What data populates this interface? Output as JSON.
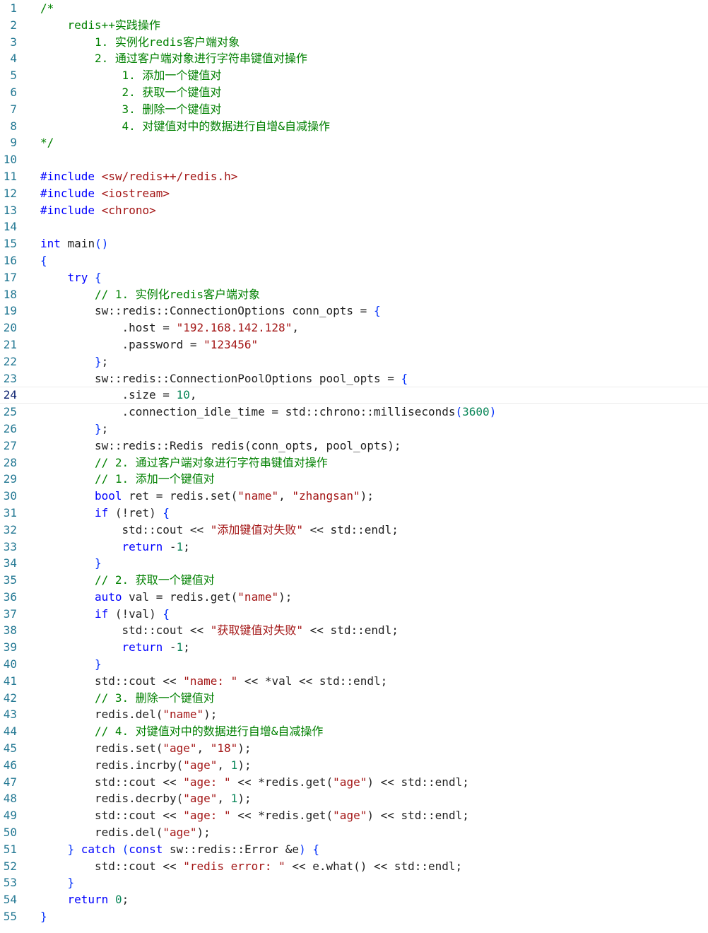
{
  "editor": {
    "current_line": 24,
    "lines": [
      {
        "n": "1",
        "indent": 0,
        "tokens": [
          {
            "t": "/*",
            "c": "comment"
          }
        ]
      },
      {
        "n": "2",
        "indent": 1,
        "tokens": [
          {
            "t": "redis++实践操作",
            "c": "comment"
          }
        ]
      },
      {
        "n": "3",
        "indent": 2,
        "tokens": [
          {
            "t": "1. 实例化redis客户端对象",
            "c": "comment"
          }
        ]
      },
      {
        "n": "4",
        "indent": 2,
        "tokens": [
          {
            "t": "2. 通过客户端对象进行字符串键值对操作",
            "c": "comment"
          }
        ]
      },
      {
        "n": "5",
        "indent": 3,
        "tokens": [
          {
            "t": "1. 添加一个键值对",
            "c": "comment"
          }
        ]
      },
      {
        "n": "6",
        "indent": 3,
        "tokens": [
          {
            "t": "2. 获取一个键值对",
            "c": "comment"
          }
        ]
      },
      {
        "n": "7",
        "indent": 3,
        "tokens": [
          {
            "t": "3. 删除一个键值对",
            "c": "comment"
          }
        ]
      },
      {
        "n": "8",
        "indent": 3,
        "tokens": [
          {
            "t": "4. 对键值对中的数据进行自增&自减操作",
            "c": "comment"
          }
        ]
      },
      {
        "n": "9",
        "indent": 0,
        "tokens": [
          {
            "t": "*/",
            "c": "comment"
          }
        ]
      },
      {
        "n": "10",
        "indent": 0,
        "tokens": []
      },
      {
        "n": "11",
        "indent": 0,
        "tokens": [
          {
            "t": "#include ",
            "c": "keyword"
          },
          {
            "t": "<sw/redis++/redis.h>",
            "c": "string"
          }
        ]
      },
      {
        "n": "12",
        "indent": 0,
        "tokens": [
          {
            "t": "#include ",
            "c": "keyword"
          },
          {
            "t": "<iostream>",
            "c": "string"
          }
        ]
      },
      {
        "n": "13",
        "indent": 0,
        "tokens": [
          {
            "t": "#include ",
            "c": "keyword"
          },
          {
            "t": "<chrono>",
            "c": "string"
          }
        ]
      },
      {
        "n": "14",
        "indent": 0,
        "tokens": []
      },
      {
        "n": "15",
        "indent": 0,
        "tokens": [
          {
            "t": "int",
            "c": "keyword"
          },
          {
            "t": " main",
            "c": "func"
          },
          {
            "t": "()",
            "c": "bracket"
          }
        ]
      },
      {
        "n": "16",
        "indent": 0,
        "tokens": [
          {
            "t": "{",
            "c": "bracket"
          }
        ]
      },
      {
        "n": "17",
        "indent": 1,
        "tokens": [
          {
            "t": "try",
            "c": "control"
          },
          {
            "t": " ",
            "c": "plain"
          },
          {
            "t": "{",
            "c": "bracket"
          }
        ]
      },
      {
        "n": "18",
        "indent": 2,
        "tokens": [
          {
            "t": "// 1. 实例化redis客户端对象",
            "c": "comment"
          }
        ]
      },
      {
        "n": "19",
        "indent": 2,
        "tokens": [
          {
            "t": "sw::redis::ConnectionOptions conn_opts = ",
            "c": "plain"
          },
          {
            "t": "{",
            "c": "bracket"
          }
        ]
      },
      {
        "n": "20",
        "indent": 3,
        "tokens": [
          {
            "t": ".host = ",
            "c": "plain"
          },
          {
            "t": "\"192.168.142.128\"",
            "c": "string"
          },
          {
            "t": ",",
            "c": "plain"
          }
        ]
      },
      {
        "n": "21",
        "indent": 3,
        "tokens": [
          {
            "t": ".password = ",
            "c": "plain"
          },
          {
            "t": "\"123456\"",
            "c": "string"
          }
        ]
      },
      {
        "n": "22",
        "indent": 2,
        "tokens": [
          {
            "t": "}",
            "c": "bracket"
          },
          {
            "t": ";",
            "c": "plain"
          }
        ]
      },
      {
        "n": "23",
        "indent": 2,
        "tokens": [
          {
            "t": "sw::redis::ConnectionPoolOptions pool_opts = ",
            "c": "plain"
          },
          {
            "t": "{",
            "c": "bracket"
          }
        ]
      },
      {
        "n": "24",
        "indent": 3,
        "tokens": [
          {
            "t": ".size = ",
            "c": "plain"
          },
          {
            "t": "10",
            "c": "number"
          },
          {
            "t": ",",
            "c": "plain"
          }
        ]
      },
      {
        "n": "25",
        "indent": 3,
        "tokens": [
          {
            "t": ".connection_idle_time = std::chrono::milliseconds",
            "c": "plain"
          },
          {
            "t": "(",
            "c": "bracket"
          },
          {
            "t": "3600",
            "c": "number"
          },
          {
            "t": ")",
            "c": "bracket"
          }
        ]
      },
      {
        "n": "26",
        "indent": 2,
        "tokens": [
          {
            "t": "}",
            "c": "bracket"
          },
          {
            "t": ";",
            "c": "plain"
          }
        ]
      },
      {
        "n": "27",
        "indent": 2,
        "tokens": [
          {
            "t": "sw::redis::Redis redis(conn_opts, pool_opts);",
            "c": "plain"
          }
        ]
      },
      {
        "n": "28",
        "indent": 2,
        "tokens": [
          {
            "t": "// 2. 通过客户端对象进行字符串键值对操作",
            "c": "comment"
          }
        ]
      },
      {
        "n": "29",
        "indent": 2,
        "tokens": [
          {
            "t": "// 1. 添加一个键值对",
            "c": "comment"
          }
        ]
      },
      {
        "n": "30",
        "indent": 2,
        "tokens": [
          {
            "t": "bool",
            "c": "keyword"
          },
          {
            "t": " ret = redis.set(",
            "c": "plain"
          },
          {
            "t": "\"name\"",
            "c": "string"
          },
          {
            "t": ", ",
            "c": "plain"
          },
          {
            "t": "\"zhangsan\"",
            "c": "string"
          },
          {
            "t": ");",
            "c": "plain"
          }
        ]
      },
      {
        "n": "31",
        "indent": 2,
        "tokens": [
          {
            "t": "if",
            "c": "control"
          },
          {
            "t": " (!ret) ",
            "c": "plain"
          },
          {
            "t": "{",
            "c": "bracket"
          }
        ]
      },
      {
        "n": "32",
        "indent": 3,
        "tokens": [
          {
            "t": "std::cout << ",
            "c": "plain"
          },
          {
            "t": "\"添加键值对失败\"",
            "c": "string"
          },
          {
            "t": " << std::endl;",
            "c": "plain"
          }
        ]
      },
      {
        "n": "33",
        "indent": 3,
        "tokens": [
          {
            "t": "return",
            "c": "control"
          },
          {
            "t": " -",
            "c": "plain"
          },
          {
            "t": "1",
            "c": "number"
          },
          {
            "t": ";",
            "c": "plain"
          }
        ]
      },
      {
        "n": "34",
        "indent": 2,
        "tokens": [
          {
            "t": "}",
            "c": "bracket"
          }
        ]
      },
      {
        "n": "35",
        "indent": 2,
        "tokens": [
          {
            "t": "// 2. 获取一个键值对",
            "c": "comment"
          }
        ]
      },
      {
        "n": "36",
        "indent": 2,
        "tokens": [
          {
            "t": "auto",
            "c": "keyword"
          },
          {
            "t": " val = redis.get(",
            "c": "plain"
          },
          {
            "t": "\"name\"",
            "c": "string"
          },
          {
            "t": ");",
            "c": "plain"
          }
        ]
      },
      {
        "n": "37",
        "indent": 2,
        "tokens": [
          {
            "t": "if",
            "c": "control"
          },
          {
            "t": " (!val) ",
            "c": "plain"
          },
          {
            "t": "{",
            "c": "bracket"
          }
        ]
      },
      {
        "n": "38",
        "indent": 3,
        "tokens": [
          {
            "t": "std::cout << ",
            "c": "plain"
          },
          {
            "t": "\"获取键值对失败\"",
            "c": "string"
          },
          {
            "t": " << std::endl;",
            "c": "plain"
          }
        ]
      },
      {
        "n": "39",
        "indent": 3,
        "tokens": [
          {
            "t": "return",
            "c": "control"
          },
          {
            "t": " -",
            "c": "plain"
          },
          {
            "t": "1",
            "c": "number"
          },
          {
            "t": ";",
            "c": "plain"
          }
        ]
      },
      {
        "n": "40",
        "indent": 2,
        "tokens": [
          {
            "t": "}",
            "c": "bracket"
          }
        ]
      },
      {
        "n": "41",
        "indent": 2,
        "tokens": [
          {
            "t": "std::cout << ",
            "c": "plain"
          },
          {
            "t": "\"name: \"",
            "c": "string"
          },
          {
            "t": " << *val << std::endl;",
            "c": "plain"
          }
        ]
      },
      {
        "n": "42",
        "indent": 2,
        "tokens": [
          {
            "t": "// 3. 删除一个键值对",
            "c": "comment"
          }
        ]
      },
      {
        "n": "43",
        "indent": 2,
        "tokens": [
          {
            "t": "redis.del(",
            "c": "plain"
          },
          {
            "t": "\"name\"",
            "c": "string"
          },
          {
            "t": ");",
            "c": "plain"
          }
        ]
      },
      {
        "n": "44",
        "indent": 2,
        "tokens": [
          {
            "t": "// 4. 对键值对中的数据进行自增&自减操作",
            "c": "comment"
          }
        ]
      },
      {
        "n": "45",
        "indent": 2,
        "tokens": [
          {
            "t": "redis.set(",
            "c": "plain"
          },
          {
            "t": "\"age\"",
            "c": "string"
          },
          {
            "t": ", ",
            "c": "plain"
          },
          {
            "t": "\"18\"",
            "c": "string"
          },
          {
            "t": ");",
            "c": "plain"
          }
        ]
      },
      {
        "n": "46",
        "indent": 2,
        "tokens": [
          {
            "t": "redis.incrby(",
            "c": "plain"
          },
          {
            "t": "\"age\"",
            "c": "string"
          },
          {
            "t": ", ",
            "c": "plain"
          },
          {
            "t": "1",
            "c": "number"
          },
          {
            "t": ");",
            "c": "plain"
          }
        ]
      },
      {
        "n": "47",
        "indent": 2,
        "tokens": [
          {
            "t": "std::cout << ",
            "c": "plain"
          },
          {
            "t": "\"age: \"",
            "c": "string"
          },
          {
            "t": " << *redis.get(",
            "c": "plain"
          },
          {
            "t": "\"age\"",
            "c": "string"
          },
          {
            "t": ") << std::endl;",
            "c": "plain"
          }
        ]
      },
      {
        "n": "48",
        "indent": 2,
        "tokens": [
          {
            "t": "redis.decrby(",
            "c": "plain"
          },
          {
            "t": "\"age\"",
            "c": "string"
          },
          {
            "t": ", ",
            "c": "plain"
          },
          {
            "t": "1",
            "c": "number"
          },
          {
            "t": ");",
            "c": "plain"
          }
        ]
      },
      {
        "n": "49",
        "indent": 2,
        "tokens": [
          {
            "t": "std::cout << ",
            "c": "plain"
          },
          {
            "t": "\"age: \"",
            "c": "string"
          },
          {
            "t": " << *redis.get(",
            "c": "plain"
          },
          {
            "t": "\"age\"",
            "c": "string"
          },
          {
            "t": ") << std::endl;",
            "c": "plain"
          }
        ]
      },
      {
        "n": "50",
        "indent": 2,
        "tokens": [
          {
            "t": "redis.del(",
            "c": "plain"
          },
          {
            "t": "\"age\"",
            "c": "string"
          },
          {
            "t": ");",
            "c": "plain"
          }
        ]
      },
      {
        "n": "51",
        "indent": 1,
        "tokens": [
          {
            "t": "}",
            "c": "bracket"
          },
          {
            "t": " ",
            "c": "plain"
          },
          {
            "t": "catch",
            "c": "control"
          },
          {
            "t": " ",
            "c": "plain"
          },
          {
            "t": "(",
            "c": "bracket"
          },
          {
            "t": "const",
            "c": "keyword"
          },
          {
            "t": " sw::redis::Error &e",
            "c": "plain"
          },
          {
            "t": ")",
            "c": "bracket"
          },
          {
            "t": " ",
            "c": "plain"
          },
          {
            "t": "{",
            "c": "bracket"
          }
        ]
      },
      {
        "n": "52",
        "indent": 2,
        "tokens": [
          {
            "t": "std::cout << ",
            "c": "plain"
          },
          {
            "t": "\"redis error: \"",
            "c": "string"
          },
          {
            "t": " << e.what() << std::endl;",
            "c": "plain"
          }
        ]
      },
      {
        "n": "53",
        "indent": 1,
        "tokens": [
          {
            "t": "}",
            "c": "bracket"
          }
        ]
      },
      {
        "n": "54",
        "indent": 1,
        "tokens": [
          {
            "t": "return",
            "c": "control"
          },
          {
            "t": " ",
            "c": "plain"
          },
          {
            "t": "0",
            "c": "number"
          },
          {
            "t": ";",
            "c": "plain"
          }
        ]
      },
      {
        "n": "55",
        "indent": 0,
        "tokens": [
          {
            "t": "}",
            "c": "bracket"
          }
        ]
      }
    ]
  }
}
